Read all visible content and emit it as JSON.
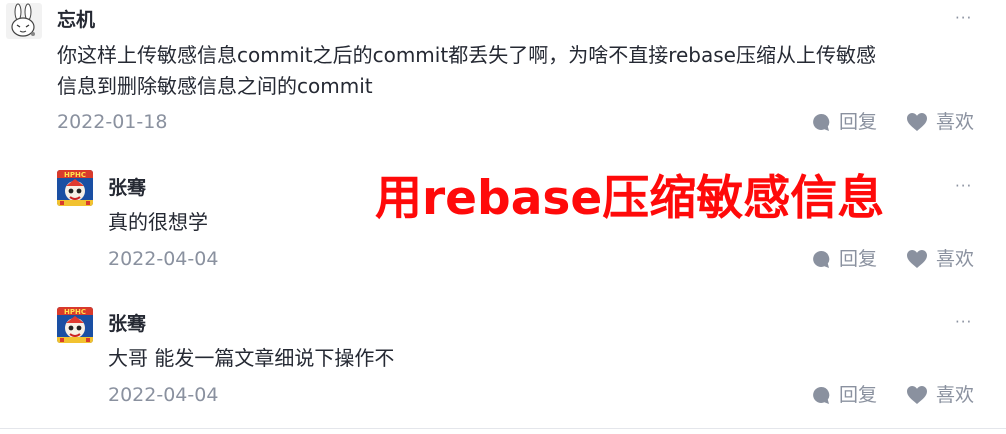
{
  "overlay": {
    "title": "用rebase压缩敏感信息"
  },
  "comment": {
    "author": "忘机",
    "text_line1": "你这样上传敏感信息commit之后的commit都丢失了啊，为啥不直接rebase压缩从上传敏感",
    "text_line2": "信息到删除敏感信息之间的commit",
    "date": "2022-01-18",
    "reply_label": "回复",
    "like_label": "喜欢",
    "more_label": "···"
  },
  "replies": [
    {
      "author": "张骞",
      "text": "真的很想学",
      "date": "2022-04-04",
      "reply_label": "回复",
      "like_label": "喜欢",
      "more_label": "···"
    },
    {
      "author": "张骞",
      "text": "大哥 能发一篇文章细说下操作不",
      "date": "2022-04-04",
      "reply_label": "回复",
      "like_label": "喜欢",
      "more_label": "···"
    }
  ],
  "colors": {
    "overlay_red": "#ff0a0a",
    "muted": "#8a919f",
    "text": "#252933"
  },
  "icons": {
    "reply": "chat-bubble-icon",
    "like": "heart-icon",
    "more": "more-dots-icon"
  }
}
